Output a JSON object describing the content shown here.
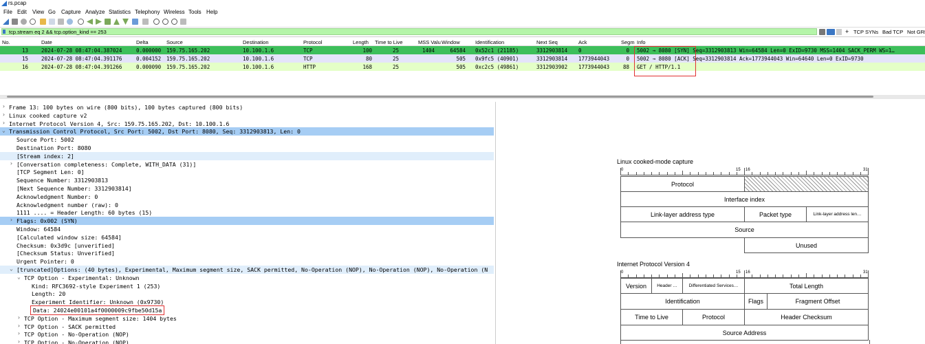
{
  "window": {
    "title": "rs.pcap"
  },
  "menu": [
    "File",
    "Edit",
    "View",
    "Go",
    "Capture",
    "Analyze",
    "Statistics",
    "Telephony",
    "Wireless",
    "Tools",
    "Help"
  ],
  "filter": {
    "value": "tcp.stream eq 2 && tcp.option_kind == 253",
    "buttons": [
      "TCP SYNs",
      "Bad TCP",
      "Not GRE"
    ]
  },
  "columns": [
    "No.",
    "Date",
    "Delta",
    "Source",
    "Destination",
    "Protocol",
    "Length",
    "Time to Live",
    "MSS Valu",
    "Window",
    "Identification",
    "Next Seq",
    "Ack",
    "Segm",
    "Info"
  ],
  "packets": [
    {
      "no": "13",
      "date": "2024-07-28 08:47:04.387024",
      "delta": "0.000000",
      "src": "159.75.165.202",
      "dst": "10.100.1.6",
      "proto": "TCP",
      "len": "100",
      "ttl": "25",
      "mss": "1404",
      "win": "64584",
      "id": "0x52c1 (21185)",
      "nseq": "3312903814",
      "ack": "0",
      "segm": "0",
      "info": "5002 → 8080 [SYN] Seq=3312903813 Win=64584 Len=0 ExID=9730 MSS=1404 SACK_PERM WS=1…",
      "bg": "#3dbf5a"
    },
    {
      "no": "15",
      "date": "2024-07-28 08:47:04.391176",
      "delta": "0.004152",
      "src": "159.75.165.202",
      "dst": "10.100.1.6",
      "proto": "TCP",
      "len": "80",
      "ttl": "25",
      "mss": "",
      "win": "505",
      "id": "0x9fc5 (40901)",
      "nseq": "3312903814",
      "ack": "1773944043",
      "segm": "0",
      "info": "5002 → 8080 [ACK] Seq=3312903814 Ack=1773944043 Win=64640 Len=0 ExID=9730",
      "bg": "#e4e4fa"
    },
    {
      "no": "16",
      "date": "2024-07-28 08:47:04.391266",
      "delta": "0.000090",
      "src": "159.75.165.202",
      "dst": "10.100.1.6",
      "proto": "HTTP",
      "len": "168",
      "ttl": "25",
      "mss": "",
      "win": "505",
      "id": "0xc2c5 (49861)",
      "nseq": "3312903902",
      "ack": "1773944043",
      "segm": "88",
      "info": "GET / HTTP/1.1",
      "bg": "#e4ffc7"
    }
  ],
  "details": [
    {
      "arrow": "›",
      "indent": 0,
      "text": "Frame 13: 100 bytes on wire (800 bits), 100 bytes captured (800 bits)",
      "hl": ""
    },
    {
      "arrow": "›",
      "indent": 0,
      "text": "Linux cooked capture v2",
      "hl": ""
    },
    {
      "arrow": "›",
      "indent": 0,
      "text": "Internet Protocol Version 4, Src: 159.75.165.202, Dst: 10.100.1.6",
      "hl": ""
    },
    {
      "arrow": "⌄",
      "indent": 0,
      "text": "Transmission Control Protocol, Src Port: 5002, Dst Port: 8080, Seq: 3312903813, Len: 0",
      "hl": "sel"
    },
    {
      "arrow": "",
      "indent": 1,
      "text": "Source Port: 5002",
      "hl": ""
    },
    {
      "arrow": "",
      "indent": 1,
      "text": "Destination Port: 8080",
      "hl": ""
    },
    {
      "arrow": "",
      "indent": 1,
      "text": "[Stream index: 2]",
      "hl": "light"
    },
    {
      "arrow": "›",
      "indent": 1,
      "text": "[Conversation completeness: Complete, WITH_DATA (31)]",
      "hl": ""
    },
    {
      "arrow": "",
      "indent": 1,
      "text": "[TCP Segment Len: 0]",
      "hl": ""
    },
    {
      "arrow": "",
      "indent": 1,
      "text": "Sequence Number: 3312903813",
      "hl": ""
    },
    {
      "arrow": "",
      "indent": 1,
      "text": "[Next Sequence Number: 3312903814]",
      "hl": ""
    },
    {
      "arrow": "",
      "indent": 1,
      "text": "Acknowledgment Number: 0",
      "hl": ""
    },
    {
      "arrow": "",
      "indent": 1,
      "text": "Acknowledgment number (raw): 0",
      "hl": ""
    },
    {
      "arrow": "",
      "indent": 1,
      "text": "1111 .... = Header Length: 60 bytes (15)",
      "hl": ""
    },
    {
      "arrow": "›",
      "indent": 1,
      "text": "Flags: 0x002 (SYN)",
      "hl": "sel"
    },
    {
      "arrow": "",
      "indent": 1,
      "text": "Window: 64584",
      "hl": ""
    },
    {
      "arrow": "",
      "indent": 1,
      "text": "[Calculated window size: 64584]",
      "hl": ""
    },
    {
      "arrow": "",
      "indent": 1,
      "text": "Checksum: 0x3d9c [unverified]",
      "hl": ""
    },
    {
      "arrow": "",
      "indent": 1,
      "text": "[Checksum Status: Unverified]",
      "hl": ""
    },
    {
      "arrow": "",
      "indent": 1,
      "text": "Urgent Pointer: 0",
      "hl": ""
    },
    {
      "arrow": "⌄",
      "indent": 1,
      "text": "[truncated]Options: (40 bytes), Experimental, Maximum segment size, SACK permitted, No-Operation (NOP), No-Operation (NOP), No-Operation (N",
      "hl": "light"
    },
    {
      "arrow": "⌄",
      "indent": 2,
      "text": "TCP Option - Experimental: Unknown",
      "hl": ""
    },
    {
      "arrow": "",
      "indent": 3,
      "text": "Kind: RFC3692-style Experiment 1 (253)",
      "hl": ""
    },
    {
      "arrow": "",
      "indent": 3,
      "text": "Length: 20",
      "hl": ""
    },
    {
      "arrow": "",
      "indent": 3,
      "text": "Experiment Identifier: Unknown (0x9730)",
      "hl": ""
    },
    {
      "arrow": "",
      "indent": 3,
      "text": "Data: 24024e00101a4f0000009c9fbe50d15a",
      "hl": "box"
    },
    {
      "arrow": "›",
      "indent": 2,
      "text": "TCP Option - Maximum segment size: 1404 bytes",
      "hl": ""
    },
    {
      "arrow": "›",
      "indent": 2,
      "text": "TCP Option - SACK permitted",
      "hl": ""
    },
    {
      "arrow": "›",
      "indent": 2,
      "text": "TCP Option - No-Operation (NOP)",
      "hl": ""
    },
    {
      "arrow": "›",
      "indent": 2,
      "text": "TCP Option - No-Operation (NOP)",
      "hl": ""
    }
  ],
  "diagrams": {
    "linux": {
      "title": "Linux cooked-mode capture",
      "ruler": [
        "0",
        "15",
        "16",
        "31"
      ],
      "cells": [
        "Protocol",
        "Interface index",
        "Link-layer address type",
        "Packet type",
        "Link-layer address len…",
        "Source",
        "Unused"
      ]
    },
    "ipv4": {
      "title": "Internet Protocol Version 4",
      "ruler": [
        "0",
        "15",
        "16",
        "31"
      ],
      "cells": [
        "Version",
        "Header …",
        "Differentiated Services…",
        "Total Length",
        "Identification",
        "Flags",
        "Fragment Offset",
        "Time to Live",
        "Protocol",
        "Header Checksum",
        "Source Address"
      ]
    }
  },
  "colors": {
    "selected": "#a6cdf4",
    "light": "#e0eefb",
    "syn": "#3dbf5a",
    "accent": "#e03030"
  }
}
